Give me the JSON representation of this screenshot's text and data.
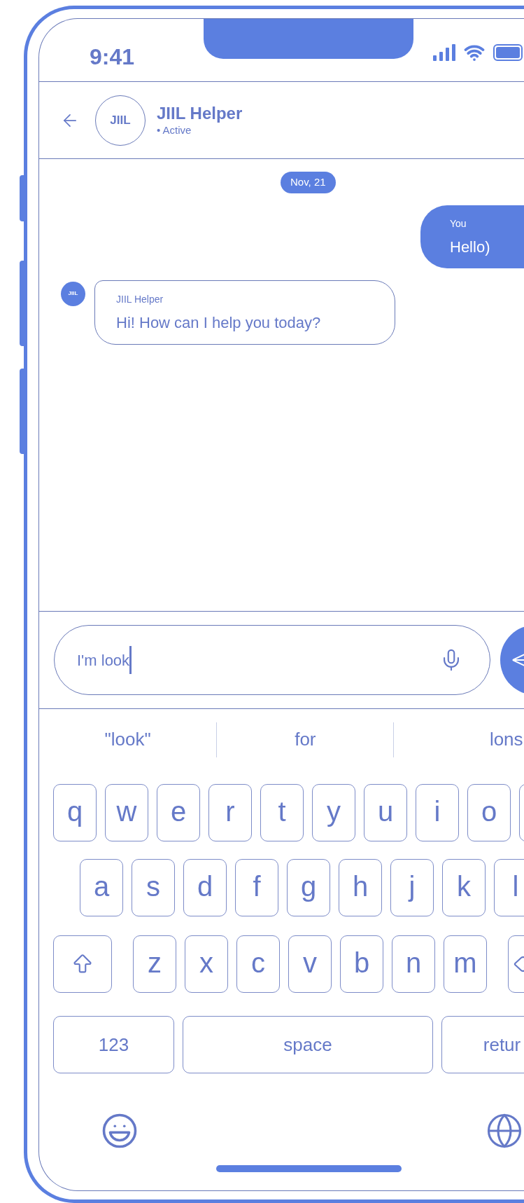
{
  "status_bar": {
    "time": "9:41"
  },
  "header": {
    "avatar_text": "JIIL",
    "name": "JIIL Helper",
    "status": "• Active"
  },
  "messages": [
    {
      "kind": "date",
      "text": "Nov, 21"
    },
    {
      "kind": "outgoing",
      "sender": "You",
      "text": "Hello)"
    },
    {
      "kind": "incoming",
      "sender": "JIIL Helper",
      "avatar_text": "JIIL",
      "text": "Hi! How can I help you today?"
    }
  ],
  "composer": {
    "value": "I'm look"
  },
  "suggestions": [
    "\"look\"",
    "for",
    "lons"
  ],
  "keyboard": {
    "rows": [
      [
        {
          "kind": "letter",
          "label": "q"
        },
        {
          "kind": "letter",
          "label": "w"
        },
        {
          "kind": "letter",
          "label": "e"
        },
        {
          "kind": "letter",
          "label": "r"
        },
        {
          "kind": "letter",
          "label": "t"
        },
        {
          "kind": "letter",
          "label": "y"
        },
        {
          "kind": "letter",
          "label": "u"
        },
        {
          "kind": "letter",
          "label": "i"
        },
        {
          "kind": "letter",
          "label": "o"
        },
        {
          "kind": "blank"
        }
      ],
      [
        {
          "kind": "letter",
          "label": "a"
        },
        {
          "kind": "letter",
          "label": "s"
        },
        {
          "kind": "letter",
          "label": "d"
        },
        {
          "kind": "letter",
          "label": "f"
        },
        {
          "kind": "letter",
          "label": "g"
        },
        {
          "kind": "letter",
          "label": "h"
        },
        {
          "kind": "letter",
          "label": "j"
        },
        {
          "kind": "letter",
          "label": "k"
        },
        {
          "kind": "letter",
          "label": "l"
        }
      ],
      [
        {
          "kind": "shift"
        },
        {
          "kind": "letter",
          "label": "z"
        },
        {
          "kind": "letter",
          "label": "x"
        },
        {
          "kind": "letter",
          "label": "c"
        },
        {
          "kind": "letter",
          "label": "v"
        },
        {
          "kind": "letter",
          "label": "b"
        },
        {
          "kind": "letter",
          "label": "n"
        },
        {
          "kind": "letter",
          "label": "m"
        },
        {
          "kind": "backspace"
        }
      ]
    ],
    "bottom_row": [
      {
        "kind": "wide",
        "label": "123"
      },
      {
        "kind": "space",
        "label": "space"
      },
      {
        "kind": "wide",
        "label": "retur"
      }
    ]
  }
}
